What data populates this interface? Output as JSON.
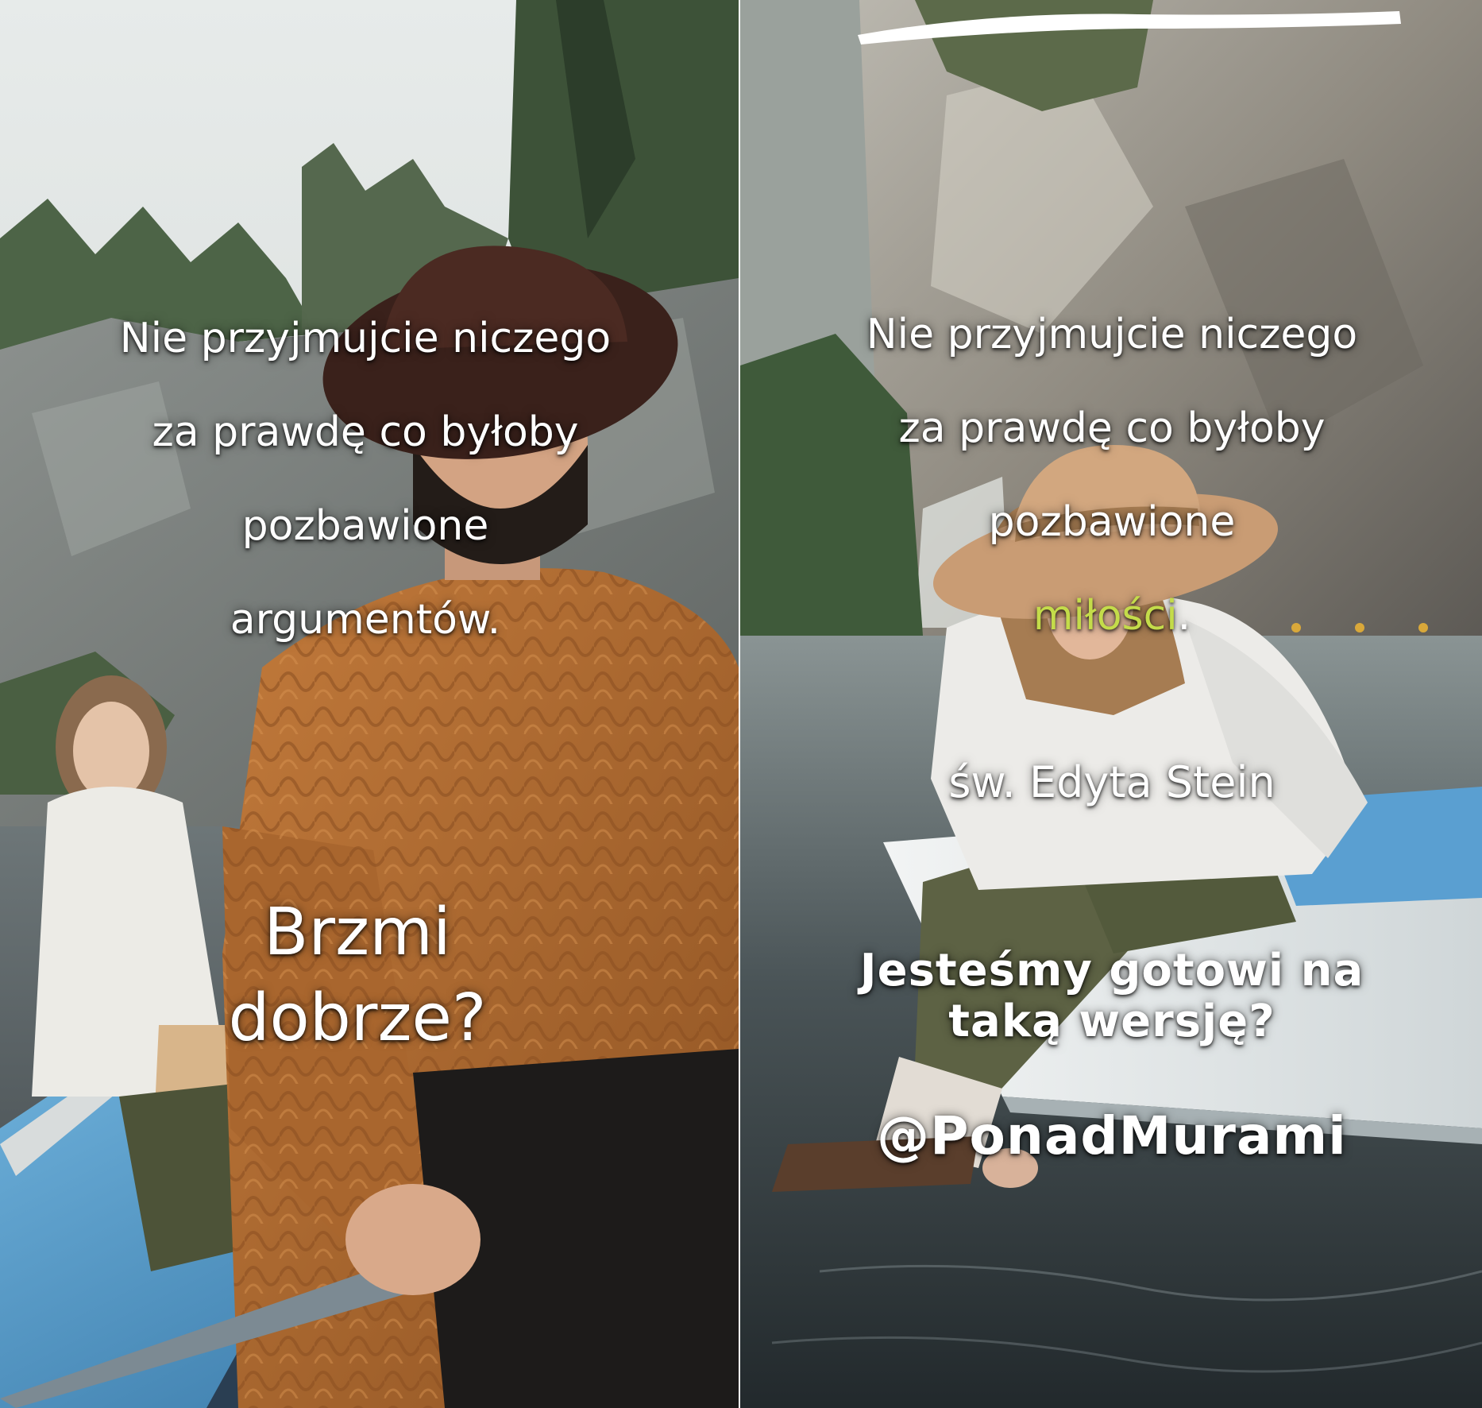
{
  "left_panel": {
    "quote_lines": [
      "Nie przyjmujcie niczego",
      "za prawdę co byłoby",
      "pozbawione",
      "argumentów."
    ],
    "question_lines": [
      "Brzmi",
      "dobrze?"
    ]
  },
  "right_panel": {
    "quote_lines": [
      "Nie przyjmujcie niczego",
      "za prawdę co byłoby",
      "pozbawione"
    ],
    "highlight_word": "miłości",
    "highlight_punct": ".",
    "author": "św. Edyta Stein",
    "cta_lines": [
      "Jesteśmy gotowi na",
      "taką wersję?"
    ],
    "handle": "@PonadMurami"
  },
  "colors": {
    "caption_text": "#ffffff",
    "highlight": "#c4dc4a",
    "sweater": "#b06a30",
    "water": "#3c444a",
    "boat_blue": "#4a8fc4"
  }
}
